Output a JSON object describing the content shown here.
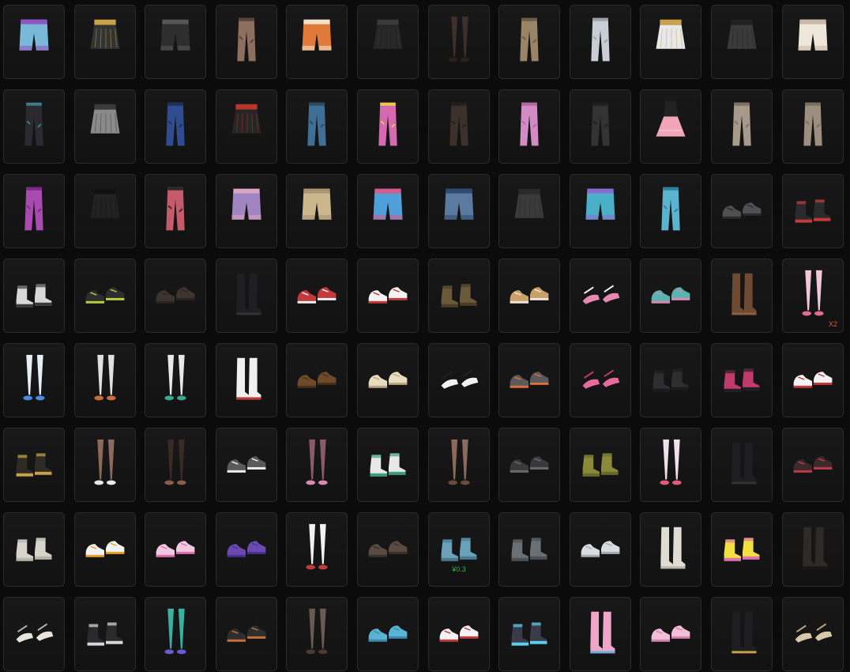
{
  "inventory": {
    "items": [
      {
        "icon": "shorts",
        "c": "#7ab8d9",
        "c2": "#8f55c2"
      },
      {
        "icon": "skirt",
        "c": "#333333",
        "c2": "#c9a24a"
      },
      {
        "icon": "shorts",
        "c": "#2e2e2e",
        "c2": "#555555"
      },
      {
        "icon": "pants",
        "c": "#8e6f5f",
        "c2": "#5a443a"
      },
      {
        "icon": "shorts",
        "c": "#e07a3a",
        "c2": "#f2e2d0"
      },
      {
        "icon": "skirt",
        "c": "#262626",
        "c2": "#3a3a3a"
      },
      {
        "icon": "stockings",
        "c": "#3d302b",
        "c2": "#2a211d"
      },
      {
        "icon": "pants",
        "c": "#9a8466",
        "c2": "#6e5c45"
      },
      {
        "icon": "pants",
        "c": "#c9ced6",
        "c2": "#9aa3ad"
      },
      {
        "icon": "skirt",
        "c": "#e8e8ea",
        "c2": "#c9a24a"
      },
      {
        "icon": "skirt",
        "c": "#3a3a3a",
        "c2": "#222222"
      },
      {
        "icon": "shorts",
        "c": "#efe6da",
        "c2": "#c9b9a5"
      },
      {
        "icon": "pants",
        "c": "#2a2a30",
        "c2": "#3f7a8a"
      },
      {
        "icon": "skirt",
        "c": "#8a8a8a",
        "c2": "#3a3a3a"
      },
      {
        "icon": "pants",
        "c": "#2f4c8f",
        "c2": "#1d2f5a"
      },
      {
        "icon": "skirt",
        "c": "#262626",
        "c2": "#b7362b"
      },
      {
        "icon": "pants",
        "c": "#3f6f95",
        "c2": "#2a4b66"
      },
      {
        "icon": "pants",
        "c": "#d66ab0",
        "c2": "#e8c84a"
      },
      {
        "icon": "pants",
        "c": "#3b302a",
        "c2": "#251e1a"
      },
      {
        "icon": "pants",
        "c": "#d38bc4",
        "c2": "#b06aa0"
      },
      {
        "icon": "pants",
        "c": "#333333",
        "c2": "#1f1f1f"
      },
      {
        "icon": "dress",
        "c": "#f0a6b8",
        "c2": "#222222"
      },
      {
        "icon": "pants",
        "c": "#a89a8a",
        "c2": "#7d7064"
      },
      {
        "icon": "pants",
        "c": "#9d8f80",
        "c2": "#7a6e62"
      },
      {
        "icon": "pants",
        "c": "#a84ab0",
        "c2": "#7a2a85"
      },
      {
        "icon": "skirt",
        "c": "#222222",
        "c2": "#111111"
      },
      {
        "icon": "pants",
        "c": "#c45a6a",
        "c2": "#2a2a30"
      },
      {
        "icon": "shorts",
        "c": "#a085c0",
        "c2": "#d9a5c5"
      },
      {
        "icon": "shorts",
        "c": "#cbb68e",
        "c2": "#a89572"
      },
      {
        "icon": "shorts",
        "c": "#4fa0d9",
        "c2": "#d65a8a"
      },
      {
        "icon": "shorts",
        "c": "#5a7aa0",
        "c2": "#2f4c6e"
      },
      {
        "icon": "skirt",
        "c": "#3a3a3a",
        "c2": "#2a2a2a"
      },
      {
        "icon": "shorts",
        "c": "#4ab0c8",
        "c2": "#8a6ad0"
      },
      {
        "icon": "pants",
        "c": "#5ab3cf",
        "c2": "#2f7f9a"
      },
      {
        "icon": "shoes",
        "c": "#505052",
        "c2": "#2a2a2c"
      },
      {
        "icon": "boots",
        "c": "#2a2a2c",
        "c2": "#c23a3a"
      },
      {
        "icon": "boots",
        "c": "#d8d8d8",
        "c2": "#3a3a3a"
      },
      {
        "icon": "shoes",
        "c": "#2e2e30",
        "c2": "#b7d23a"
      },
      {
        "icon": "shoes",
        "c": "#3d3430",
        "c2": "#2a2421"
      },
      {
        "icon": "tall-boots",
        "c": "#1f1f21",
        "c2": "#333333"
      },
      {
        "icon": "shoes",
        "c": "#c23a3a",
        "c2": "#f2f2f2"
      },
      {
        "icon": "shoes",
        "c": "#f2f2f2",
        "c2": "#c23a3a"
      },
      {
        "icon": "boots",
        "c": "#6b5a3a",
        "c2": "#4a3d28"
      },
      {
        "icon": "shoes",
        "c": "#c9a06a",
        "c2": "#f0e6d8"
      },
      {
        "icon": "heels",
        "c": "#e888b0",
        "c2": "#f5f5f5"
      },
      {
        "icon": "shoes",
        "c": "#5ab3b0",
        "c2": "#d68ab0"
      },
      {
        "icon": "tall-boots",
        "c": "#6e4a32",
        "c2": "#8a5e40"
      },
      {
        "icon": "stockings",
        "c": "#f2c8d8",
        "c2": "#e06a9a",
        "qty": "X2"
      },
      {
        "icon": "stockings",
        "c": "#e8eef5",
        "c2": "#4a8ae0"
      },
      {
        "icon": "stockings",
        "c": "#e0e0e0",
        "c2": "#c9703a"
      },
      {
        "icon": "stockings",
        "c": "#e8e8e8",
        "c2": "#3aa88a"
      },
      {
        "icon": "tall-boots",
        "c": "#f0f0f0",
        "c2": "#c23a3a"
      },
      {
        "icon": "shoes",
        "c": "#6e4a2a",
        "c2": "#4a3018"
      },
      {
        "icon": "shoes",
        "c": "#e8dcc0",
        "c2": "#b8a880"
      },
      {
        "icon": "heels",
        "c": "#f2f2f2",
        "c2": "#222222"
      },
      {
        "icon": "shoes",
        "c": "#5a5a5c",
        "c2": "#e0703a"
      },
      {
        "icon": "heels",
        "c": "#e86a9a",
        "c2": "#c23a6a"
      },
      {
        "icon": "boots",
        "c": "#2e2e30",
        "c2": "#1a1a1a"
      },
      {
        "icon": "boots",
        "c": "#c23a6a",
        "c2": "#1f1f21"
      },
      {
        "icon": "shoes",
        "c": "#f2f2f2",
        "c2": "#c23a3a"
      },
      {
        "icon": "boots",
        "c": "#2e2a24",
        "c2": "#c9a24a"
      },
      {
        "icon": "stockings",
        "c": "#8a6a5a",
        "c2": "#e8e8e8"
      },
      {
        "icon": "stockings",
        "c": "#3a2a24",
        "c2": "#8a5a4a"
      },
      {
        "icon": "shoes",
        "c": "#5a5a5c",
        "c2": "#f0f0f0"
      },
      {
        "icon": "stockings",
        "c": "#8a5a6a",
        "c2": "#d88ab0"
      },
      {
        "icon": "boots",
        "c": "#e8e8e8",
        "c2": "#3aa07a"
      },
      {
        "icon": "stockings",
        "c": "#8a6a5a",
        "c2": "#6a4a3a"
      },
      {
        "icon": "shoes",
        "c": "#3a3a3c",
        "c2": "#6a6a6c"
      },
      {
        "icon": "boots",
        "c": "#8a8a3a",
        "c2": "#6a6a2a"
      },
      {
        "icon": "stockings",
        "c": "#f0e0e8",
        "c2": "#e05a7a"
      },
      {
        "icon": "tall-boots",
        "c": "#1f1f21",
        "c2": "#333333"
      },
      {
        "icon": "shoes",
        "c": "#3a2a2c",
        "c2": "#c23a4a"
      },
      {
        "icon": "boots",
        "c": "#d8d4cc",
        "c2": "#b8b4ac"
      },
      {
        "icon": "shoes",
        "c": "#f2f2f2",
        "c2": "#e8a02a"
      },
      {
        "icon": "shoes",
        "c": "#f0c8e0",
        "c2": "#e070b0"
      },
      {
        "icon": "shoes",
        "c": "#6a4ab0",
        "c2": "#4a3090"
      },
      {
        "icon": "stockings",
        "c": "#f2f2f2",
        "c2": "#c23a3a"
      },
      {
        "icon": "shoes",
        "c": "#5a4a40",
        "c2": "#3a302a"
      },
      {
        "icon": "boots",
        "c": "#6aa0b8",
        "c2": "#4a7a90",
        "price": "¥0.3"
      },
      {
        "icon": "boots",
        "c": "#6a7075",
        "c2": "#4a5055"
      },
      {
        "icon": "shoes",
        "c": "#d8dce0",
        "c2": "#a8acb0"
      },
      {
        "icon": "tall-boots",
        "c": "#e0dcd4",
        "c2": "#b8b4ac"
      },
      {
        "icon": "boots",
        "c": "#f0e040",
        "c2": "#e070b0"
      },
      {
        "icon": "tall-boots",
        "c": "#2e2a28",
        "c2": "#1a1614"
      },
      {
        "icon": "heels",
        "c": "#e8e4dc",
        "c2": "#b8b4ac"
      },
      {
        "icon": "boots",
        "c": "#2a2a2c",
        "c2": "#d8d8d8"
      },
      {
        "icon": "stockings",
        "c": "#3ab0a0",
        "c2": "#6a5ad0"
      },
      {
        "icon": "shoes",
        "c": "#2e2e30",
        "c2": "#c9703a"
      },
      {
        "icon": "stockings",
        "c": "#6a5a52",
        "c2": "#4a3a32"
      },
      {
        "icon": "shoes",
        "c": "#5ab3d0",
        "c2": "#3a8ab0"
      },
      {
        "icon": "shoes",
        "c": "#f2f2f2",
        "c2": "#c23a3a"
      },
      {
        "icon": "boots",
        "c": "#3a3a4a",
        "c2": "#5ad0f0"
      },
      {
        "icon": "tall-boots",
        "c": "#f0a6c8",
        "c2": "#6ab0e0"
      },
      {
        "icon": "shoes",
        "c": "#f0c0d8",
        "c2": "#d880b0"
      },
      {
        "icon": "tall-boots",
        "c": "#1f1f21",
        "c2": "#c9a24a"
      },
      {
        "icon": "heels",
        "c": "#d8c8a8",
        "c2": "#b8a888"
      }
    ]
  }
}
